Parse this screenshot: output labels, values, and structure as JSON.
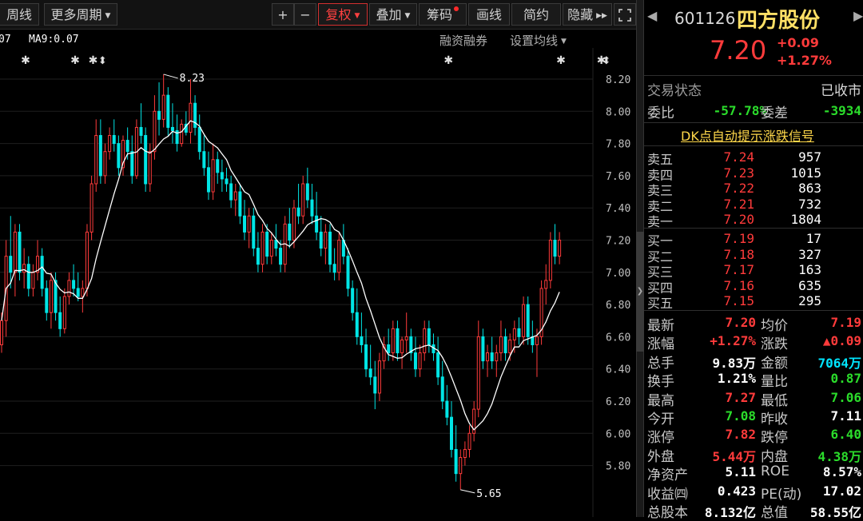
{
  "toolbar": {
    "period_week": "周线",
    "more_periods": "更多周期",
    "zoom_in": "+",
    "zoom_out": "−",
    "adjust": "复权",
    "overlay": "叠加",
    "chips": "筹码",
    "draw": "画线",
    "simple": "简约",
    "hide": "隐藏",
    "fullscreen_icon": "fullscreen-icon"
  },
  "chart_header": {
    "ma_partial": "07",
    "ma9": "MA9:0.07",
    "margin": "融资融券",
    "ma_settings": "设置均线"
  },
  "colors": {
    "up": "#ff3b3b",
    "down": "#00e5e5",
    "ma": "#ffffff",
    "bg": "#000000",
    "grid": "#1f1f1f"
  },
  "chart_data": {
    "type": "candlestick",
    "ylim": [
      5.6,
      8.28
    ],
    "yticks": [
      "8.20",
      "8.00",
      "7.80",
      "7.60",
      "7.40",
      "7.20",
      "7.00",
      "6.80",
      "6.60",
      "6.40",
      "6.20",
      "6.00",
      "5.80"
    ],
    "max_label": "8.23",
    "min_label": "5.65",
    "max_value": 8.23,
    "min_value": 5.65,
    "event_marks": [
      5,
      16,
      20,
      99,
      124,
      133
    ],
    "event_arrows": [
      22,
      134
    ],
    "candles": [
      [
        6.55,
        6.75,
        6.5,
        6.7
      ],
      [
        6.7,
        7.2,
        6.6,
        7.1
      ],
      [
        7.1,
        7.35,
        6.9,
        7.0
      ],
      [
        7.0,
        7.3,
        6.85,
        7.25
      ],
      [
        7.25,
        7.3,
        6.95,
        7.0
      ],
      [
        7.0,
        7.15,
        6.9,
        7.05
      ],
      [
        7.05,
        7.1,
        6.85,
        6.9
      ],
      [
        6.9,
        7.05,
        6.85,
        7.0
      ],
      [
        7.0,
        7.2,
        6.95,
        7.1
      ],
      [
        7.1,
        7.15,
        6.85,
        6.9
      ],
      [
        6.9,
        6.95,
        6.7,
        6.75
      ],
      [
        6.75,
        7.0,
        6.65,
        6.95
      ],
      [
        6.95,
        7.0,
        6.7,
        6.75
      ],
      [
        6.75,
        6.85,
        6.6,
        6.65
      ],
      [
        6.65,
        6.9,
        6.62,
        6.85
      ],
      [
        6.85,
        7.0,
        6.8,
        6.95
      ],
      [
        6.95,
        7.05,
        6.85,
        6.9
      ],
      [
        6.9,
        7.0,
        6.82,
        6.85
      ],
      [
        6.85,
        6.95,
        6.75,
        6.9
      ],
      [
        6.9,
        7.3,
        6.85,
        7.25
      ],
      [
        7.25,
        7.6,
        7.2,
        7.55
      ],
      [
        7.55,
        7.95,
        7.5,
        7.85
      ],
      [
        7.85,
        7.95,
        7.55,
        7.6
      ],
      [
        7.6,
        7.8,
        7.55,
        7.75
      ],
      [
        7.75,
        7.9,
        7.7,
        7.85
      ],
      [
        7.85,
        7.95,
        7.75,
        7.8
      ],
      [
        7.8,
        7.85,
        7.6,
        7.65
      ],
      [
        7.65,
        7.85,
        7.6,
        7.82
      ],
      [
        7.82,
        7.9,
        7.7,
        7.75
      ],
      [
        7.75,
        7.85,
        7.55,
        7.6
      ],
      [
        7.6,
        7.95,
        7.58,
        7.9
      ],
      [
        7.9,
        8.05,
        7.8,
        7.85
      ],
      [
        7.85,
        7.9,
        7.5,
        7.55
      ],
      [
        7.55,
        7.8,
        7.5,
        7.75
      ],
      [
        7.75,
        8.1,
        7.7,
        8.0
      ],
      [
        8.0,
        8.18,
        7.85,
        7.95
      ],
      [
        7.95,
        8.23,
        7.9,
        8.1
      ],
      [
        8.1,
        8.15,
        7.85,
        7.9
      ],
      [
        7.9,
        8.05,
        7.8,
        7.88
      ],
      [
        7.88,
        7.98,
        7.75,
        7.8
      ],
      [
        7.8,
        7.95,
        7.78,
        7.92
      ],
      [
        7.92,
        8.0,
        7.85,
        7.87
      ],
      [
        7.87,
        8.2,
        7.8,
        8.05
      ],
      [
        8.05,
        8.1,
        7.85,
        7.9
      ],
      [
        7.9,
        7.98,
        7.7,
        7.75
      ],
      [
        7.75,
        7.85,
        7.6,
        7.65
      ],
      [
        7.65,
        7.75,
        7.45,
        7.5
      ],
      [
        7.5,
        7.8,
        7.45,
        7.7
      ],
      [
        7.7,
        7.75,
        7.55,
        7.62
      ],
      [
        7.62,
        7.7,
        7.5,
        7.58
      ],
      [
        7.58,
        7.65,
        7.5,
        7.55
      ],
      [
        7.55,
        7.6,
        7.4,
        7.45
      ],
      [
        7.45,
        7.55,
        7.35,
        7.5
      ],
      [
        7.5,
        7.55,
        7.3,
        7.35
      ],
      [
        7.35,
        7.45,
        7.2,
        7.25
      ],
      [
        7.25,
        7.4,
        7.15,
        7.35
      ],
      [
        7.35,
        7.4,
        7.1,
        7.15
      ],
      [
        7.15,
        7.25,
        7.0,
        7.05
      ],
      [
        7.05,
        7.3,
        7.0,
        7.25
      ],
      [
        7.25,
        7.3,
        7.05,
        7.1
      ],
      [
        7.1,
        7.25,
        7.05,
        7.2
      ],
      [
        7.2,
        7.3,
        7.1,
        7.15
      ],
      [
        7.15,
        7.2,
        7.0,
        7.05
      ],
      [
        7.05,
        7.35,
        7.0,
        7.3
      ],
      [
        7.3,
        7.4,
        7.15,
        7.2
      ],
      [
        7.2,
        7.45,
        7.15,
        7.4
      ],
      [
        7.4,
        7.55,
        7.3,
        7.35
      ],
      [
        7.35,
        7.6,
        7.3,
        7.55
      ],
      [
        7.55,
        7.65,
        7.4,
        7.45
      ],
      [
        7.45,
        7.55,
        7.3,
        7.35
      ],
      [
        7.35,
        7.5,
        7.2,
        7.25
      ],
      [
        7.25,
        7.35,
        7.1,
        7.15
      ],
      [
        7.15,
        7.3,
        7.05,
        7.25
      ],
      [
        7.25,
        7.3,
        7.0,
        7.05
      ],
      [
        7.05,
        7.15,
        6.95,
        7.0
      ],
      [
        7.0,
        7.25,
        6.95,
        7.2
      ],
      [
        7.2,
        7.3,
        7.05,
        7.1
      ],
      [
        7.1,
        7.15,
        6.85,
        6.9
      ],
      [
        6.9,
        6.95,
        6.7,
        6.75
      ],
      [
        6.75,
        6.9,
        6.55,
        6.6
      ],
      [
        6.6,
        6.75,
        6.5,
        6.55
      ],
      [
        6.55,
        6.65,
        6.35,
        6.4
      ],
      [
        6.4,
        6.55,
        6.3,
        6.35
      ],
      [
        6.35,
        6.45,
        6.15,
        6.25
      ],
      [
        6.25,
        6.5,
        6.2,
        6.45
      ],
      [
        6.45,
        6.6,
        6.4,
        6.55
      ],
      [
        6.55,
        6.65,
        6.45,
        6.5
      ],
      [
        6.5,
        6.7,
        6.45,
        6.65
      ],
      [
        6.65,
        6.7,
        6.45,
        6.5
      ],
      [
        6.5,
        6.6,
        6.4,
        6.58
      ],
      [
        6.58,
        6.75,
        6.5,
        6.6
      ],
      [
        6.6,
        6.65,
        6.45,
        6.5
      ],
      [
        6.5,
        6.6,
        6.35,
        6.4
      ],
      [
        6.4,
        6.55,
        6.35,
        6.5
      ],
      [
        6.5,
        6.7,
        6.45,
        6.65
      ],
      [
        6.65,
        6.7,
        6.5,
        6.55
      ],
      [
        6.55,
        6.62,
        6.45,
        6.5
      ],
      [
        6.5,
        6.6,
        6.3,
        6.35
      ],
      [
        6.35,
        6.45,
        6.15,
        6.2
      ],
      [
        6.2,
        6.3,
        6.05,
        6.1
      ],
      [
        6.1,
        6.2,
        5.85,
        5.9
      ],
      [
        5.9,
        6.05,
        5.7,
        5.75
      ],
      [
        5.75,
        5.9,
        5.65,
        5.85
      ],
      [
        5.85,
        5.95,
        5.8,
        5.9
      ],
      [
        5.9,
        6.05,
        5.85,
        6.0
      ],
      [
        6.0,
        6.2,
        5.95,
        6.15
      ],
      [
        6.15,
        6.7,
        6.1,
        6.6
      ],
      [
        6.6,
        6.65,
        6.4,
        6.45
      ],
      [
        6.45,
        6.55,
        6.35,
        6.5
      ],
      [
        6.5,
        6.6,
        6.4,
        6.45
      ],
      [
        6.45,
        6.55,
        6.35,
        6.5
      ],
      [
        6.5,
        6.7,
        6.45,
        6.6
      ],
      [
        6.6,
        6.65,
        6.45,
        6.5
      ],
      [
        6.5,
        6.62,
        6.45,
        6.58
      ],
      [
        6.58,
        6.7,
        6.5,
        6.65
      ],
      [
        6.65,
        6.72,
        6.55,
        6.6
      ],
      [
        6.6,
        6.85,
        6.55,
        6.8
      ],
      [
        6.8,
        6.85,
        6.55,
        6.6
      ],
      [
        6.6,
        6.7,
        6.5,
        6.55
      ],
      [
        6.55,
        6.65,
        6.35,
        6.6
      ],
      [
        6.6,
        6.95,
        6.55,
        6.9
      ],
      [
        6.9,
        7.05,
        6.8,
        6.95
      ],
      [
        6.95,
        7.25,
        6.9,
        7.2
      ],
      [
        7.2,
        7.3,
        7.05,
        7.1
      ],
      [
        7.1,
        7.25,
        7.05,
        7.2
      ]
    ]
  },
  "quote": {
    "code": "601126",
    "name": "四方股份",
    "price": "7.20",
    "change": "+0.09",
    "change_pct": "+1.27%",
    "status_label": "交易状态",
    "status_value": "已收市",
    "weibi_label": "委比",
    "weibi_value": "-57.78%",
    "weicha_label": "委差",
    "weicha_value": "-3934",
    "dk_link": "DK点自动提示涨跌信号"
  },
  "orderbook": {
    "asks": [
      {
        "label": "卖五",
        "price": "7.24",
        "vol": "957"
      },
      {
        "label": "卖四",
        "price": "7.23",
        "vol": "1015"
      },
      {
        "label": "卖三",
        "price": "7.22",
        "vol": "863"
      },
      {
        "label": "卖二",
        "price": "7.21",
        "vol": "732"
      },
      {
        "label": "卖一",
        "price": "7.20",
        "vol": "1804"
      }
    ],
    "bids": [
      {
        "label": "买一",
        "price": "7.19",
        "vol": "17"
      },
      {
        "label": "买二",
        "price": "7.18",
        "vol": "327"
      },
      {
        "label": "买三",
        "price": "7.17",
        "vol": "163"
      },
      {
        "label": "买四",
        "price": "7.16",
        "vol": "635"
      },
      {
        "label": "买五",
        "price": "7.15",
        "vol": "295"
      }
    ]
  },
  "stats": [
    {
      "l1": "最新",
      "v1": "7.20",
      "c1": "red",
      "l2": "均价",
      "v2": "7.19",
      "c2": "red"
    },
    {
      "l1": "涨幅",
      "v1": "+1.27%",
      "c1": "red",
      "l2": "涨跌",
      "v2": "▲0.09",
      "c2": "red"
    },
    {
      "l1": "总手",
      "v1": "9.83万",
      "c1": "white",
      "l2": "金额",
      "v2": "7064万",
      "c2": "cyan"
    },
    {
      "l1": "换手",
      "v1": "1.21%",
      "c1": "white",
      "l2": "量比",
      "v2": "0.87",
      "c2": "green"
    },
    {
      "l1": "最高",
      "v1": "7.27",
      "c1": "red",
      "l2": "最低",
      "v2": "7.06",
      "c2": "green"
    },
    {
      "l1": "今开",
      "v1": "7.08",
      "c1": "green",
      "l2": "昨收",
      "v2": "7.11",
      "c2": "white"
    },
    {
      "l1": "涨停",
      "v1": "7.82",
      "c1": "red",
      "l2": "跌停",
      "v2": "6.40",
      "c2": "green"
    },
    {
      "l1": "外盘",
      "v1": "5.44万",
      "c1": "red",
      "l2": "内盘",
      "v2": "4.38万",
      "c2": "green"
    },
    {
      "l1": "净资产",
      "v1": "5.11",
      "c1": "white",
      "l2": "ROE",
      "v2": "8.57%",
      "c2": "white"
    },
    {
      "l1": "收益㈣",
      "v1": "0.423",
      "c1": "white",
      "l2": "PE(动)",
      "v2": "17.02",
      "c2": "white"
    },
    {
      "l1": "总股本",
      "v1": "8.132亿",
      "c1": "white",
      "l2": "总值",
      "v2": "58.55亿",
      "c2": "white"
    }
  ]
}
